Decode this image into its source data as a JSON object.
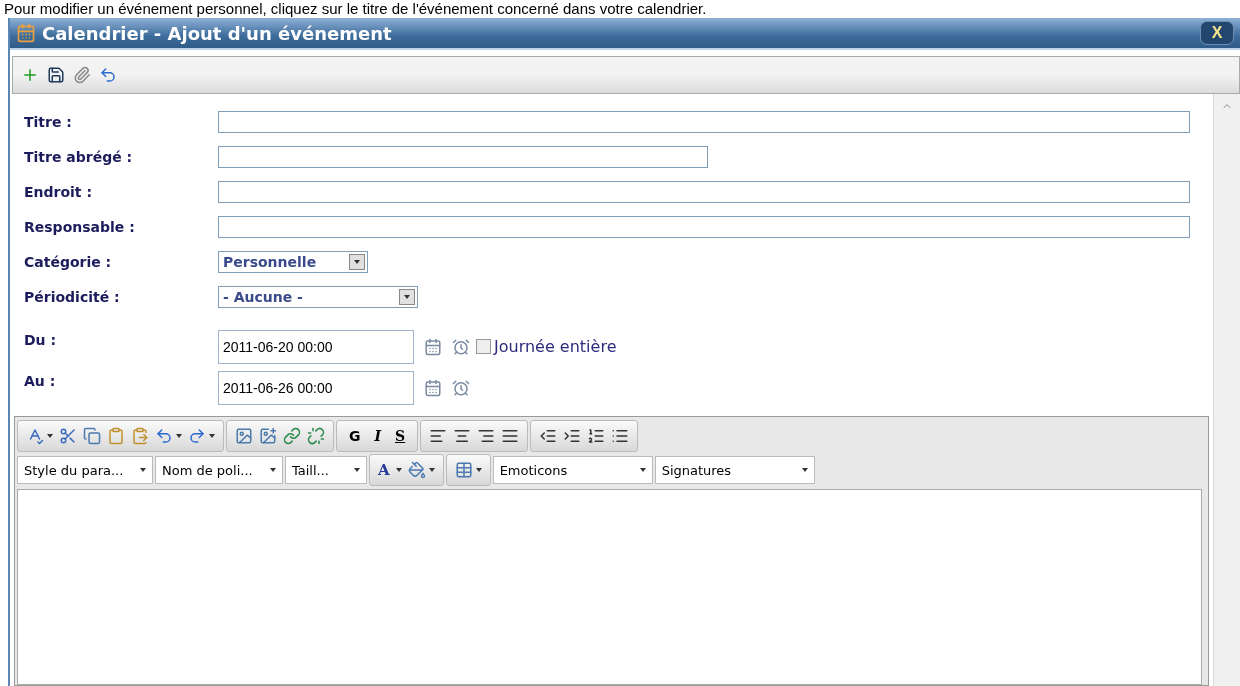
{
  "instruction": "Pour modifier un événement personnel, cliquez sur le titre de l'événement concerné dans votre calendrier.",
  "window": {
    "title": "Calendrier - Ajout d'un événement",
    "close": "X"
  },
  "form": [
    {
      "label": "Titre :",
      "kind": "text"
    },
    {
      "label": "Titre abrégé :",
      "kind": "short_text"
    },
    {
      "label": "Endroit :",
      "kind": "text"
    },
    {
      "label": "Responsable :",
      "kind": "text"
    },
    {
      "label": "Catégorie :",
      "kind": "select",
      "value": "Personnelle"
    },
    {
      "label": "Périodicité :",
      "kind": "select",
      "value": "- Aucune -"
    }
  ],
  "dates": [
    {
      "label": "Du :",
      "value": "2011-06-20 00:00",
      "all_day": {
        "label": "Journée entière",
        "checked": false
      }
    },
    {
      "label": "Au :",
      "value": "2011-06-26 00:00"
    }
  ],
  "editor": {
    "format_buttons": [
      "G",
      "I",
      "S"
    ],
    "dropdowns": [
      {
        "label": "Style du para..."
      },
      {
        "label": "Nom de poli..."
      },
      {
        "label": "Taill..."
      }
    ],
    "font_color": "A",
    "lists": [
      {
        "label": "Emoticons"
      },
      {
        "label": "Signatures"
      }
    ]
  }
}
